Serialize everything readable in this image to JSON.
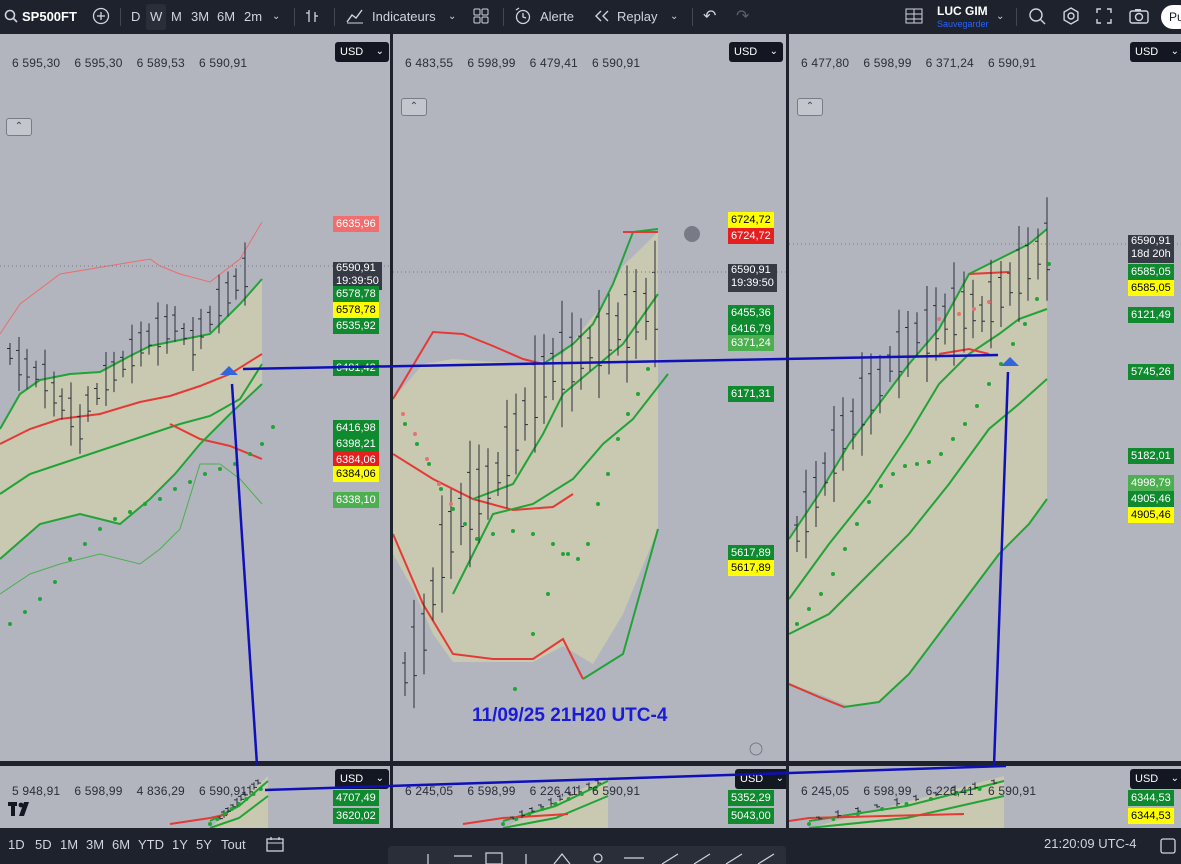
{
  "topbar": {
    "symbol": "SP500FT",
    "intervals": [
      "D",
      "W",
      "M",
      "3M",
      "6M",
      "2m"
    ],
    "indicators": "Indicateurs",
    "alert": "Alerte",
    "replay": "Replay",
    "layout_name": "LUC GIM",
    "save_status": "Sauvegarder",
    "publish": "Pu"
  },
  "bottombar": {
    "ranges": [
      "1D",
      "5D",
      "1M",
      "3M",
      "6M",
      "YTD",
      "1Y",
      "5Y",
      "Tout"
    ],
    "clock": "21:20:09 UTC-4"
  },
  "annotation": {
    "text": "11/09/25 21H20 UTC-4",
    "color": "#1a1ad9"
  },
  "currency": "USD",
  "colors": {
    "up_band": "#22a338",
    "down_band": "#e53935",
    "fill": "#c9c8b0",
    "bg": "#b2b5be",
    "line": "#1010b8"
  },
  "panes": [
    {
      "ohlc": [
        "6 595,30",
        "6 595,30",
        "6 589,53",
        "6 590,91"
      ],
      "labels": [
        {
          "t": "6635,96",
          "bg": "#f26d6d",
          "fg": "#ffffff"
        },
        {
          "t": "6590,91",
          "t2": "19:39:50",
          "bg": "#363a45",
          "fg": "#ffffff"
        },
        {
          "t": "6578,78",
          "bg": "#0f8a2e",
          "fg": "#ffffff"
        },
        {
          "t": "6578,78",
          "bg": "#ffff00",
          "fg": "#000000"
        },
        {
          "t": "6535,92",
          "bg": "#0f8a2e",
          "fg": "#ffffff"
        },
        {
          "t": "6481,42",
          "bg": "#0f8a2e",
          "fg": "#ffffff"
        },
        {
          "t": "6416,98",
          "bg": "#0f8a2e",
          "fg": "#ffffff"
        },
        {
          "t": "6398,21",
          "bg": "#0f8a2e",
          "fg": "#ffffff"
        },
        {
          "t": "6384,06",
          "bg": "#e61e1e",
          "fg": "#ffffff"
        },
        {
          "t": "6384,06",
          "bg": "#ffff00",
          "fg": "#000000"
        },
        {
          "t": "6338,10",
          "bg": "#4caf50",
          "fg": "#ffffff"
        }
      ]
    },
    {
      "ohlc": [
        "6 483,55",
        "6 598,99",
        "6 479,41",
        "6 590,91"
      ],
      "labels": [
        {
          "t": "6724,72",
          "bg": "#ffff00",
          "fg": "#000000"
        },
        {
          "t": "6724,72",
          "bg": "#e61e1e",
          "fg": "#ffffff"
        },
        {
          "t": "6590,91",
          "t2": "19:39:50",
          "bg": "#363a45",
          "fg": "#ffffff"
        },
        {
          "t": "6455,36",
          "bg": "#0f8a2e",
          "fg": "#ffffff"
        },
        {
          "t": "6416,79",
          "bg": "#0f8a2e",
          "fg": "#ffffff"
        },
        {
          "t": "6371,24",
          "bg": "#4caf50",
          "fg": "#ffffff"
        },
        {
          "t": "6171,31",
          "bg": "#0f8a2e",
          "fg": "#ffffff"
        },
        {
          "t": "5617,89",
          "bg": "#0f8a2e",
          "fg": "#ffffff"
        },
        {
          "t": "5617,89",
          "bg": "#ffff00",
          "fg": "#000000"
        }
      ]
    },
    {
      "ohlc": [
        "6 477,80",
        "6 598,99",
        "6 371,24",
        "6 590,91"
      ],
      "labels": [
        {
          "t": "6590,91",
          "t2": "18d 20h",
          "bg": "#363a45",
          "fg": "#ffffff"
        },
        {
          "t": "6585,05",
          "bg": "#0f8a2e",
          "fg": "#ffffff"
        },
        {
          "t": "6585,05",
          "bg": "#ffff00",
          "fg": "#000000"
        },
        {
          "t": "6121,49",
          "bg": "#0f8a2e",
          "fg": "#ffffff"
        },
        {
          "t": "5745,26",
          "bg": "#0f8a2e",
          "fg": "#ffffff"
        },
        {
          "t": "5182,01",
          "bg": "#0f8a2e",
          "fg": "#ffffff"
        },
        {
          "t": "4998,79",
          "bg": "#4caf50",
          "fg": "#ffffff"
        },
        {
          "t": "4905,46",
          "bg": "#0f8a2e",
          "fg": "#ffffff"
        },
        {
          "t": "4905,46",
          "bg": "#ffff00",
          "fg": "#000000"
        }
      ]
    },
    {
      "ohlc": [
        "5 948,91",
        "6 598,99",
        "4 836,29",
        "6 590,91"
      ],
      "labels": [
        {
          "t": "4707,49",
          "bg": "#0f8a2e",
          "fg": "#ffffff"
        },
        {
          "t": "3620,02",
          "bg": "#0f8a2e",
          "fg": "#ffffff"
        }
      ]
    },
    {
      "ohlc": [
        "6 245,05",
        "6 598,99",
        "6 226,41",
        "6 590,91"
      ],
      "labels": [
        {
          "t": "5352,29",
          "bg": "#0f8a2e",
          "fg": "#ffffff"
        },
        {
          "t": "5043,00",
          "bg": "#0f8a2e",
          "fg": "#ffffff"
        }
      ]
    },
    {
      "ohlc": [
        "6 245,05",
        "6 598,99",
        "6 226,41",
        "6 590,91"
      ],
      "labels": [
        {
          "t": "6344,53",
          "bg": "#0f8a2e",
          "fg": "#ffffff"
        },
        {
          "t": "6344,53",
          "bg": "#ffff00",
          "fg": "#000000"
        }
      ]
    }
  ],
  "chart_data": [
    {
      "type": "candlestick",
      "pane": 1,
      "price_axis_labels": [
        "6635,96",
        "6590,91",
        "6578,78",
        "6535,92",
        "6481,42",
        "6416,98",
        "6398,21",
        "6384,06",
        "6338,10"
      ],
      "last": 6590.91
    },
    {
      "type": "candlestick",
      "pane": 2,
      "price_axis_labels": [
        "6724,72",
        "6590,91",
        "6455,36",
        "6416,79",
        "6371,24",
        "6171,31",
        "5617,89"
      ],
      "last": 6590.91
    },
    {
      "type": "candlestick",
      "pane": 3,
      "price_axis_labels": [
        "6590,91",
        "6585,05",
        "6121,49",
        "5745,26",
        "5182,01",
        "4998,79",
        "4905,46"
      ],
      "last": 6590.91
    }
  ]
}
